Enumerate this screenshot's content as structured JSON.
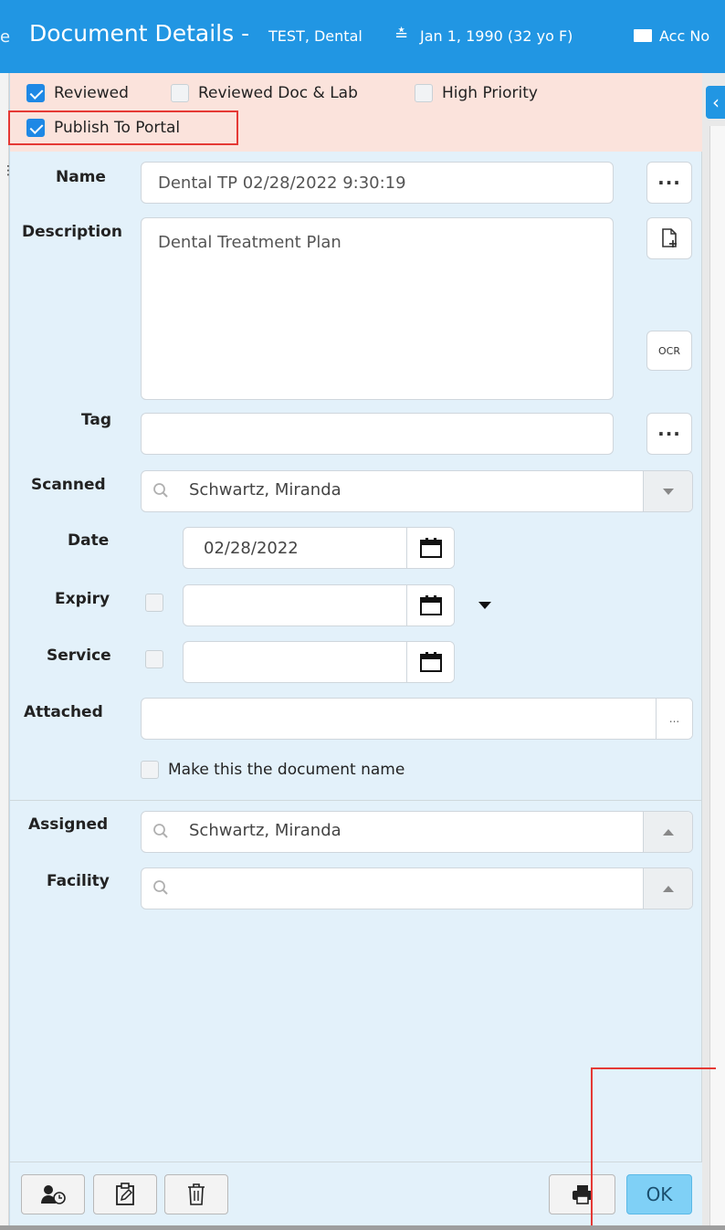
{
  "header": {
    "lead": "e",
    "title": "Document Details -",
    "patient": "TEST, Dental",
    "dob": "Jan 1, 1990 (32 yo F)",
    "account": "Acc No"
  },
  "flags": {
    "reviewed": {
      "label": "Reviewed",
      "checked": true
    },
    "reviewed_doc_lab": {
      "label": "Reviewed Doc & Lab",
      "checked": false
    },
    "high_priority": {
      "label": "High Priority",
      "checked": false
    },
    "publish_to_portal": {
      "label": "Publish To Portal",
      "checked": true
    }
  },
  "form": {
    "name": {
      "label": "Name",
      "value": "Dental TP 02/28/2022 9:30:19"
    },
    "description": {
      "label": "Description",
      "value": "Dental Treatment Plan"
    },
    "ocr_label": "OCR",
    "tag": {
      "label": "Tag",
      "value": ""
    },
    "scanned": {
      "label": "Scanned",
      "value": "Schwartz, Miranda"
    },
    "date": {
      "label": "Date",
      "value": "02/28/2022"
    },
    "expiry": {
      "label": "Expiry",
      "value": ""
    },
    "service": {
      "label": "Service",
      "value": ""
    },
    "attached": {
      "label": "Attached",
      "value": "",
      "button": "..."
    },
    "make_doc_name": {
      "label": "Make this the document name",
      "checked": false
    },
    "assigned": {
      "label": "Assigned",
      "value": "Schwartz, Miranda"
    },
    "facility": {
      "label": "Facility",
      "value": ""
    }
  },
  "footer": {
    "ok_label": "OK"
  },
  "colors": {
    "header_bg": "#2196e3",
    "dialog_bg": "#e3f1fa",
    "flags_bg": "#fbe3dc",
    "checkbox_checked": "#1e88e5",
    "ok_button": "#7fd0f6",
    "highlight": "#e53935"
  }
}
